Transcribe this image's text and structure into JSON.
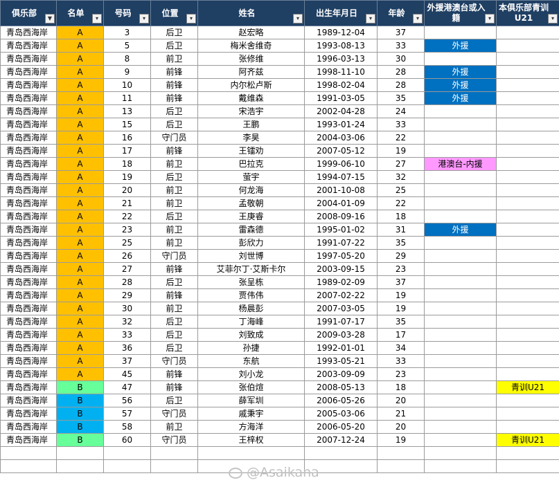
{
  "headers": {
    "club": "俱乐部",
    "list": "名单",
    "number": "号码",
    "position": "位置",
    "name": "姓名",
    "birth": "出生年月日",
    "age": "年龄",
    "foreign": "外援港澳台或入籍",
    "youth": "本俱乐部青训U21"
  },
  "filter_icon_active": "▼",
  "filter_icon": "▾",
  "watermark": "@Asaikana",
  "colors": {
    "header_bg": "#1f3f63",
    "list_a": "#ffc000",
    "list_b_green": "#66ff99",
    "list_b_blue": "#00b0f0",
    "foreign_tag": "#0070c0",
    "hkmt_tag": "#ff99ff",
    "youth_tag": "#ffff00"
  },
  "rows": [
    {
      "club": "青岛西海岸",
      "list": "A",
      "list_color": "a",
      "number": "3",
      "position": "后卫",
      "name": "赵宏略",
      "birth": "1989-12-04",
      "age": "37",
      "foreign": "",
      "foreign_type": "",
      "youth": ""
    },
    {
      "club": "青岛西海岸",
      "list": "A",
      "list_color": "a",
      "number": "5",
      "position": "后卫",
      "name": "梅米舍维奇",
      "birth": "1993-08-13",
      "age": "33",
      "foreign": "外援",
      "foreign_type": "foreign",
      "youth": ""
    },
    {
      "club": "青岛西海岸",
      "list": "A",
      "list_color": "a",
      "number": "8",
      "position": "前卫",
      "name": "张修维",
      "birth": "1996-03-13",
      "age": "30",
      "foreign": "",
      "foreign_type": "",
      "youth": ""
    },
    {
      "club": "青岛西海岸",
      "list": "A",
      "list_color": "a",
      "number": "9",
      "position": "前锋",
      "name": "阿齐兹",
      "birth": "1998-11-10",
      "age": "28",
      "foreign": "外援",
      "foreign_type": "foreign",
      "youth": ""
    },
    {
      "club": "青岛西海岸",
      "list": "A",
      "list_color": "a",
      "number": "10",
      "position": "前锋",
      "name": "内尔松卢斯",
      "birth": "1998-02-04",
      "age": "28",
      "foreign": "外援",
      "foreign_type": "foreign",
      "youth": ""
    },
    {
      "club": "青岛西海岸",
      "list": "A",
      "list_color": "a",
      "number": "11",
      "position": "前锋",
      "name": "戴维森",
      "birth": "1991-03-05",
      "age": "35",
      "foreign": "外援",
      "foreign_type": "foreign",
      "youth": ""
    },
    {
      "club": "青岛西海岸",
      "list": "A",
      "list_color": "a",
      "number": "13",
      "position": "后卫",
      "name": "宋浩宇",
      "birth": "2002-04-28",
      "age": "24",
      "foreign": "",
      "foreign_type": "",
      "youth": ""
    },
    {
      "club": "青岛西海岸",
      "list": "A",
      "list_color": "a",
      "number": "15",
      "position": "后卫",
      "name": "王鹏",
      "birth": "1993-01-24",
      "age": "33",
      "foreign": "",
      "foreign_type": "",
      "youth": ""
    },
    {
      "club": "青岛西海岸",
      "list": "A",
      "list_color": "a",
      "number": "16",
      "position": "守门员",
      "name": "李昊",
      "birth": "2004-03-06",
      "age": "22",
      "foreign": "",
      "foreign_type": "",
      "youth": ""
    },
    {
      "club": "青岛西海岸",
      "list": "A",
      "list_color": "a",
      "number": "17",
      "position": "前锋",
      "name": "王镭劝",
      "birth": "2007-05-12",
      "age": "19",
      "foreign": "",
      "foreign_type": "",
      "youth": ""
    },
    {
      "club": "青岛西海岸",
      "list": "A",
      "list_color": "a",
      "number": "18",
      "position": "前卫",
      "name": "巴拉克",
      "birth": "1999-06-10",
      "age": "27",
      "foreign": "港澳台-内援",
      "foreign_type": "hkmt",
      "youth": ""
    },
    {
      "club": "青岛西海岸",
      "list": "A",
      "list_color": "a",
      "number": "19",
      "position": "后卫",
      "name": "萤宇",
      "birth": "1994-07-15",
      "age": "32",
      "foreign": "",
      "foreign_type": "",
      "youth": ""
    },
    {
      "club": "青岛西海岸",
      "list": "A",
      "list_color": "a",
      "number": "20",
      "position": "前卫",
      "name": "何龙海",
      "birth": "2001-10-08",
      "age": "25",
      "foreign": "",
      "foreign_type": "",
      "youth": ""
    },
    {
      "club": "青岛西海岸",
      "list": "A",
      "list_color": "a",
      "number": "21",
      "position": "前卫",
      "name": "孟敬朝",
      "birth": "2004-01-09",
      "age": "22",
      "foreign": "",
      "foreign_type": "",
      "youth": ""
    },
    {
      "club": "青岛西海岸",
      "list": "A",
      "list_color": "a",
      "number": "22",
      "position": "后卫",
      "name": "王庚睿",
      "birth": "2008-09-16",
      "age": "18",
      "foreign": "",
      "foreign_type": "",
      "youth": ""
    },
    {
      "club": "青岛西海岸",
      "list": "A",
      "list_color": "a",
      "number": "23",
      "position": "前卫",
      "name": "雷森德",
      "birth": "1995-01-02",
      "age": "31",
      "foreign": "外援",
      "foreign_type": "foreign",
      "youth": ""
    },
    {
      "club": "青岛西海岸",
      "list": "A",
      "list_color": "a",
      "number": "25",
      "position": "前卫",
      "name": "彭欣力",
      "birth": "1991-07-22",
      "age": "35",
      "foreign": "",
      "foreign_type": "",
      "youth": ""
    },
    {
      "club": "青岛西海岸",
      "list": "A",
      "list_color": "a",
      "number": "26",
      "position": "守门员",
      "name": "刘世博",
      "birth": "1997-05-20",
      "age": "29",
      "foreign": "",
      "foreign_type": "",
      "youth": ""
    },
    {
      "club": "青岛西海岸",
      "list": "A",
      "list_color": "a",
      "number": "27",
      "position": "前锋",
      "name": "艾菲尔丁·艾斯卡尔",
      "birth": "2003-09-15",
      "age": "23",
      "foreign": "",
      "foreign_type": "",
      "youth": ""
    },
    {
      "club": "青岛西海岸",
      "list": "A",
      "list_color": "a",
      "number": "28",
      "position": "后卫",
      "name": "张呈栋",
      "birth": "1989-02-09",
      "age": "37",
      "foreign": "",
      "foreign_type": "",
      "youth": ""
    },
    {
      "club": "青岛西海岸",
      "list": "A",
      "list_color": "a",
      "number": "29",
      "position": "前锋",
      "name": "贾伟伟",
      "birth": "2007-02-22",
      "age": "19",
      "foreign": "",
      "foreign_type": "",
      "youth": ""
    },
    {
      "club": "青岛西海岸",
      "list": "A",
      "list_color": "a",
      "number": "30",
      "position": "前卫",
      "name": "杨晨彭",
      "birth": "2007-03-05",
      "age": "19",
      "foreign": "",
      "foreign_type": "",
      "youth": ""
    },
    {
      "club": "青岛西海岸",
      "list": "A",
      "list_color": "a",
      "number": "32",
      "position": "后卫",
      "name": "丁海峰",
      "birth": "1991-07-17",
      "age": "35",
      "foreign": "",
      "foreign_type": "",
      "youth": ""
    },
    {
      "club": "青岛西海岸",
      "list": "A",
      "list_color": "a",
      "number": "33",
      "position": "后卫",
      "name": "刘致成",
      "birth": "2009-03-28",
      "age": "17",
      "foreign": "",
      "foreign_type": "",
      "youth": ""
    },
    {
      "club": "青岛西海岸",
      "list": "A",
      "list_color": "a",
      "number": "36",
      "position": "后卫",
      "name": "孙捷",
      "birth": "1992-01-01",
      "age": "34",
      "foreign": "",
      "foreign_type": "",
      "youth": ""
    },
    {
      "club": "青岛西海岸",
      "list": "A",
      "list_color": "a",
      "number": "37",
      "position": "守门员",
      "name": "东航",
      "birth": "1993-05-21",
      "age": "33",
      "foreign": "",
      "foreign_type": "",
      "youth": ""
    },
    {
      "club": "青岛西海岸",
      "list": "A",
      "list_color": "a",
      "number": "45",
      "position": "前锋",
      "name": "刘小龙",
      "birth": "2003-09-09",
      "age": "23",
      "foreign": "",
      "foreign_type": "",
      "youth": ""
    },
    {
      "club": "青岛西海岸",
      "list": "B",
      "list_color": "b-green",
      "number": "47",
      "position": "前锋",
      "name": "张伯煊",
      "birth": "2008-05-13",
      "age": "18",
      "foreign": "",
      "foreign_type": "",
      "youth": "青训U21"
    },
    {
      "club": "青岛西海岸",
      "list": "B",
      "list_color": "b-blue",
      "number": "56",
      "position": "后卫",
      "name": "薛军圳",
      "birth": "2006-05-26",
      "age": "20",
      "foreign": "",
      "foreign_type": "",
      "youth": ""
    },
    {
      "club": "青岛西海岸",
      "list": "B",
      "list_color": "b-blue",
      "number": "57",
      "position": "守门员",
      "name": "戚秉宇",
      "birth": "2005-03-06",
      "age": "21",
      "foreign": "",
      "foreign_type": "",
      "youth": ""
    },
    {
      "club": "青岛西海岸",
      "list": "B",
      "list_color": "b-blue",
      "number": "58",
      "position": "前卫",
      "name": "方海洋",
      "birth": "2006-05-20",
      "age": "20",
      "foreign": "",
      "foreign_type": "",
      "youth": ""
    },
    {
      "club": "青岛西海岸",
      "list": "B",
      "list_color": "b-green",
      "number": "60",
      "position": "守门员",
      "name": "王梓权",
      "birth": "2007-12-24",
      "age": "19",
      "foreign": "",
      "foreign_type": "",
      "youth": "青训U21"
    }
  ]
}
